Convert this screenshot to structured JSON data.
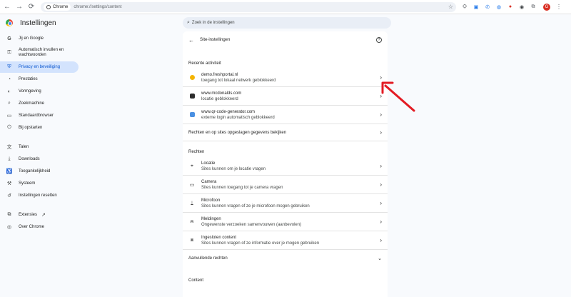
{
  "browser": {
    "site_chip": "Chrome",
    "url": "chrome://settings/content"
  },
  "header": {
    "title": "Instellingen",
    "search_placeholder": "Zoek in de instellingen"
  },
  "sidebar": {
    "items": [
      {
        "label": "Jij en Google",
        "icon": "google-g-icon"
      },
      {
        "label": "Automatisch invullen en wachtwoorden",
        "icon": "key-icon"
      },
      {
        "label": "Privacy en beveiliging",
        "icon": "shield-icon",
        "active": true
      },
      {
        "label": "Prestaties",
        "icon": "speedometer-icon"
      },
      {
        "label": "Vormgeving",
        "icon": "palette-icon"
      },
      {
        "label": "Zoekmachine",
        "icon": "search-icon"
      },
      {
        "label": "Standaardbrowser",
        "icon": "browser-icon"
      },
      {
        "label": "Bij opstarten",
        "icon": "power-icon"
      },
      {
        "label": "Talen",
        "icon": "translate-icon"
      },
      {
        "label": "Downloads",
        "icon": "download-icon"
      },
      {
        "label": "Toegankelijkheid",
        "icon": "accessibility-icon"
      },
      {
        "label": "Systeem",
        "icon": "wrench-icon"
      },
      {
        "label": "Instellingen resetten",
        "icon": "reset-icon"
      },
      {
        "label": "Extensies",
        "icon": "puzzle-icon"
      },
      {
        "label": "Over Chrome",
        "icon": "chrome-icon"
      }
    ]
  },
  "panel": {
    "title": "Site-instellingen",
    "recent_label": "Recente activiteit",
    "recent": [
      {
        "site": "demo.freshportal.nl",
        "detail": "toegang tot lokaal netwerk geblokkeerd",
        "favicon_color": "#f4b400"
      },
      {
        "site": "www.mcdonalds.com",
        "detail": "locatie geblokkeerd",
        "favicon_color": "#2d2d2d"
      },
      {
        "site": "www.qr-code-generator.com",
        "detail": "externe login automatisch geblokkeerd",
        "favicon_color": "#4a90e2"
      }
    ],
    "all_sites_label": "Rechten en op sites opgeslagen gegevens bekijken",
    "permissions_label": "Rechten",
    "permissions": [
      {
        "title": "Locatie",
        "detail": "Sites kunnen om je locatie vragen",
        "icon": "location-pin-icon"
      },
      {
        "title": "Camera",
        "detail": "Sites kunnen toegang tot je camera vragen",
        "icon": "camera-icon"
      },
      {
        "title": "Microfoon",
        "detail": "Sites kunnen vragen of ze je microfoon mogen gebruiken",
        "icon": "microphone-icon"
      },
      {
        "title": "Meldingen",
        "detail": "Ongewenste verzoeken samenvouwen (aanbevolen)",
        "icon": "bell-icon"
      },
      {
        "title": "Ingesloten content",
        "detail": "Sites kunnen vragen of ze informatie over je mogen gebruiken",
        "icon": "embedded-content-icon"
      }
    ],
    "additional_label": "Aanvullende rechten",
    "content_label": "Content"
  },
  "colors": {
    "accent": "#0b57d0",
    "active_bg": "#d3e3fd",
    "annotation_arrow": "#e31b23"
  }
}
